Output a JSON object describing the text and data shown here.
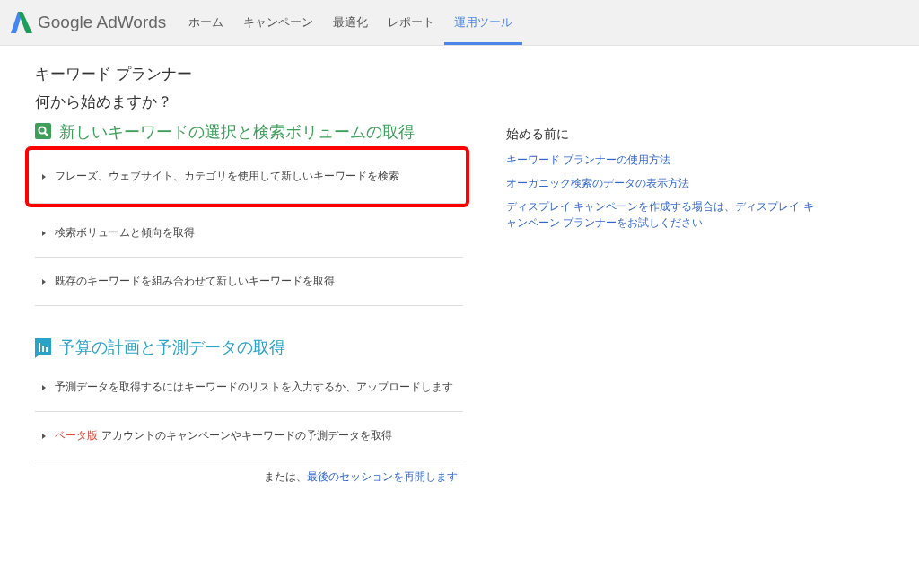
{
  "header": {
    "logo_text": "Google AdWords",
    "nav": [
      {
        "label": "ホーム",
        "selected": false
      },
      {
        "label": "キャンペーン",
        "selected": false
      },
      {
        "label": "最適化",
        "selected": false
      },
      {
        "label": "レポート",
        "selected": false
      },
      {
        "label": "運用ツール",
        "selected": true
      }
    ]
  },
  "page": {
    "title": "キーワード プランナー",
    "subtitle": "何から始めますか？"
  },
  "sections": [
    {
      "kind": "search",
      "heading": "新しいキーワードの選択と検索ボリュームの取得",
      "color": "#3d9f5a",
      "items": [
        {
          "text": "フレーズ、ウェブサイト、カテゴリを使用して新しいキーワードを検索",
          "highlighted": true
        },
        {
          "text": "検索ボリュームと傾向を取得",
          "highlighted": false
        },
        {
          "text": "既存のキーワードを組み合わせて新しいキーワードを取得",
          "highlighted": false
        }
      ]
    },
    {
      "kind": "chart",
      "heading": "予算の計画と予測データの取得",
      "color": "#2aa3c8",
      "items": [
        {
          "text": "予測データを取得するにはキーワードのリストを入力するか、アップロードします",
          "highlighted": false
        },
        {
          "badge": "ベータ版",
          "text": "アカウントのキャンペーンやキーワードの予測データを取得",
          "highlighted": false
        }
      ]
    }
  ],
  "resume": {
    "prefix": "または、",
    "link": "最後のセッションを再開します"
  },
  "sidebar": {
    "heading": "始める前に",
    "links": [
      "キーワード プランナーの使用方法",
      "オーガニック検索のデータの表示方法",
      "ディスプレイ キャンペーンを作成する場合は、ディスプレイ キャンペーン プランナーをお試しください"
    ]
  }
}
